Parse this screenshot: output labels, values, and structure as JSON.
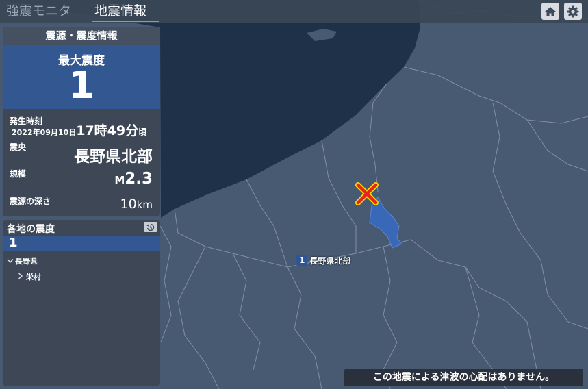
{
  "header": {
    "tabs": [
      {
        "label": "強震モニタ",
        "active": false
      },
      {
        "label": "地震情報",
        "active": true
      }
    ]
  },
  "icons": {
    "home": "home-icon",
    "settings": "gear-icon",
    "history": "history-icon"
  },
  "summary": {
    "title": "震源・震度情報",
    "max_intensity_label": "最大震度",
    "max_intensity": "1",
    "occurred_label": "発生時刻",
    "date": "2022年09月10日",
    "time": "17時49分",
    "time_suffix": "頃",
    "epicenter_label": "震央",
    "epicenter": "長野県北部",
    "magnitude_label": "規模",
    "magnitude_prefix": "M",
    "magnitude": "2.3",
    "depth_label": "震源の深さ",
    "depth_value": "10",
    "depth_unit": "km"
  },
  "local": {
    "title": "各地の震度",
    "intensity": "1",
    "prefecture": "長野県",
    "city": "栄村"
  },
  "map": {
    "region_label": "長野県北部",
    "region_intensity": "1"
  },
  "notice": "この地震による津波の心配はありません。",
  "colors": {
    "accent": "#335891",
    "sea": "#1e3148",
    "land": "#485a72",
    "epicenter": "#e8231d"
  }
}
